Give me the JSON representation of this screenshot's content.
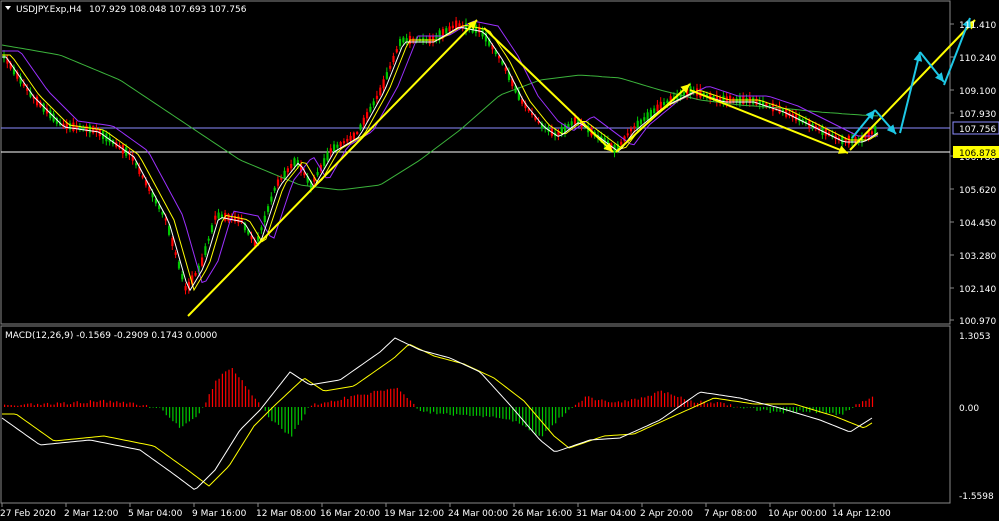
{
  "window": {
    "title": "USDJPY.Exp,H4",
    "ohlc": "107.929 108.048 107.693 107.756"
  },
  "price_axis": {
    "ticks": [
      "111.410",
      "110.240",
      "109.100",
      "107.930",
      "106.780",
      "105.620",
      "104.450",
      "103.280",
      "102.140",
      "100.970"
    ],
    "current_price": "107.756",
    "marker_price": "106.878"
  },
  "macd": {
    "title": "MACD(12,26,9) -0.1569 -0.2909 0.1743 0.0000",
    "ticks": [
      "1.3053",
      "0.00",
      "-1.5598"
    ]
  },
  "time_axis": {
    "labels": [
      "27 Feb 2020",
      "2 Mar 12:00",
      "5 Mar 04:00",
      "9 Mar 16:00",
      "12 Mar 08:00",
      "16 Mar 20:00",
      "19 Mar 12:00",
      "24 Mar 00:00",
      "26 Mar 16:00",
      "31 Mar 04:00",
      "2 Apr 20:00",
      "7 Apr 08:00",
      "10 Apr 00:00",
      "14 Apr 12:00"
    ]
  },
  "colors": {
    "bull": "#00c800",
    "bear": "#ff0000",
    "ma_fast": "#ffffff",
    "ma_mid": "#ffff00",
    "ma_slow": "#9b30ff",
    "ma_long": "#3cb43c",
    "trend": "#ffff00",
    "forecast": "#1ec8e6",
    "macd_line": "#ffffff",
    "signal_line": "#ffff00",
    "hline_current": "#8c8cff",
    "hline_marker": "#ffffff",
    "marker_bg": "#ffff00"
  }
}
